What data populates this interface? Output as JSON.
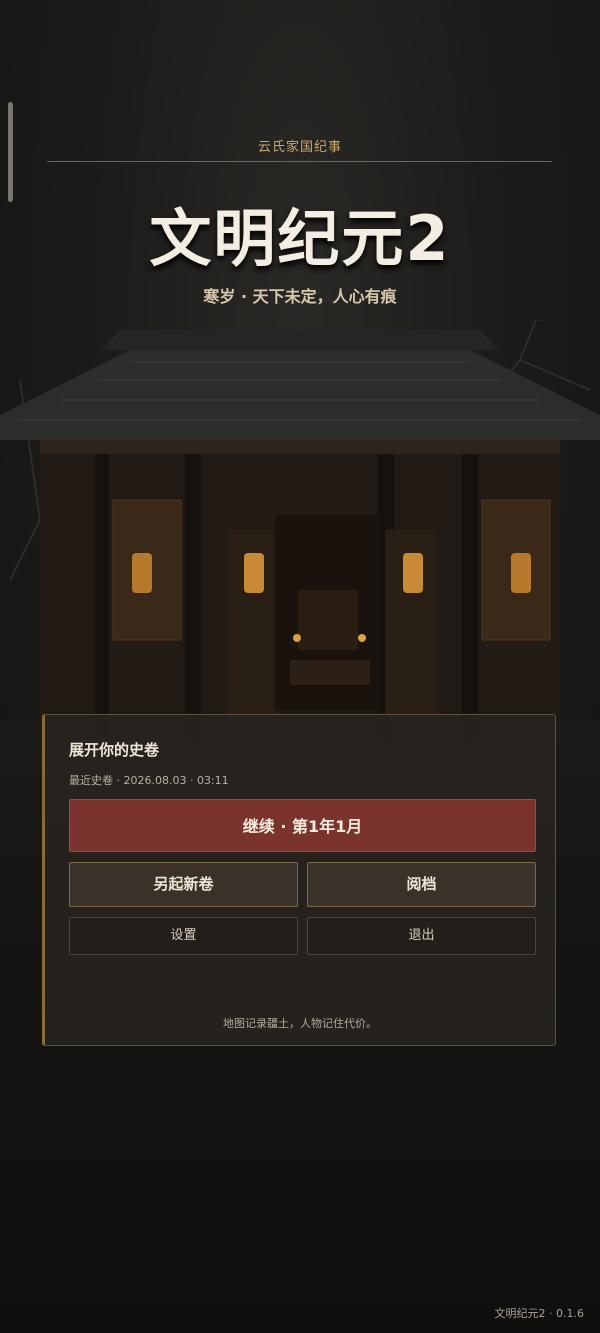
{
  "header": {
    "subtitle": "云氏家国纪事",
    "title": "文明纪元2",
    "tagline": "寒岁 · 天下未定，人心有痕"
  },
  "panel": {
    "title": "展开你的史卷",
    "recent_save": "最近史卷 · 2026.08.03 · 03:11",
    "continue_label": "继续 · 第1年1月",
    "new_game_label": "另起新卷",
    "load_label": "阅档",
    "settings_label": "设置",
    "quit_label": "退出",
    "footnote": "地图记录疆土，人物记住代价。"
  },
  "footer": {
    "version": "文明纪元2 · 0.1.6"
  },
  "colors": {
    "accent_gold": "#c9a96a",
    "continue_red": "#7a332d",
    "panel_bg": "#26221e"
  }
}
